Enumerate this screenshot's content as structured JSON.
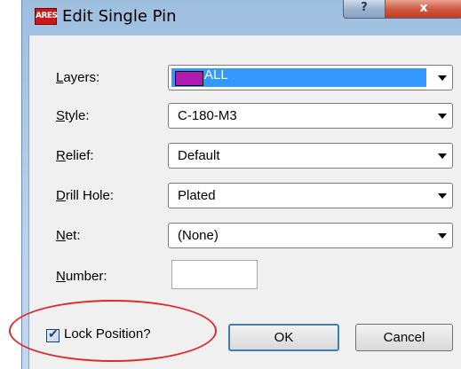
{
  "window": {
    "title": "Edit Single Pin",
    "app_icon_text": "ARES",
    "help_glyph": "?",
    "close_glyph": "x"
  },
  "form": {
    "layers": {
      "label_u": "L",
      "label_rest": "ayers:",
      "value": "ALL",
      "swatch_color": "#b01ab0"
    },
    "style": {
      "label_u": "S",
      "label_rest": "tyle:",
      "value": "C-180-M3"
    },
    "relief": {
      "label_u": "R",
      "label_rest": "elief:",
      "value": "Default"
    },
    "drill": {
      "label_u": "D",
      "label_rest": "rill Hole:",
      "value": "Plated"
    },
    "net": {
      "label_u": "N",
      "label_rest": "et:",
      "value": "(None)"
    },
    "number": {
      "label_u": "N",
      "label_rest": "umber:",
      "value": ""
    }
  },
  "lock": {
    "label": "Lock Position?",
    "checked": true
  },
  "buttons": {
    "ok": "OK",
    "cancel": "Cancel"
  },
  "annotation": {
    "color": "#e02a2a",
    "shape": "ellipse"
  }
}
